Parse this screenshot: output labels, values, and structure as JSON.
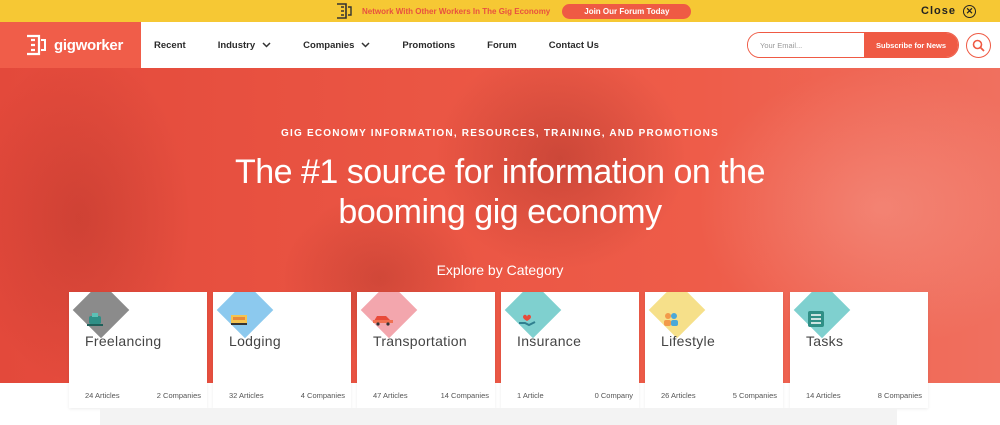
{
  "topbar": {
    "message": "Network With Other Workers In The Gig Economy",
    "button_label": "Join Our Forum Today",
    "close_label": "Close"
  },
  "header": {
    "logo_text": "gigworker",
    "nav": [
      {
        "label": "Recent",
        "has_dropdown": false
      },
      {
        "label": "Industry",
        "has_dropdown": true
      },
      {
        "label": "Companies",
        "has_dropdown": true
      },
      {
        "label": "Promotions",
        "has_dropdown": false
      },
      {
        "label": "Forum",
        "has_dropdown": false
      },
      {
        "label": "Contact Us",
        "has_dropdown": false
      }
    ],
    "email_placeholder": "Your Email...",
    "subscribe_label": "Subscribe for News"
  },
  "hero": {
    "kicker": "GIG ECONOMY INFORMATION, RESOURCES, TRAINING, AND PROMOTIONS",
    "title_line1": "The #1 source for information on the",
    "title_line2": "booming gig economy",
    "explore_label": "Explore by Category"
  },
  "categories": [
    {
      "name": "Freelancing",
      "articles": "24 Articles",
      "companies": "2 Companies",
      "color": "#8b8b8b",
      "icon": "sewing-machine-icon"
    },
    {
      "name": "Lodging",
      "articles": "32 Articles",
      "companies": "4 Companies",
      "color": "#8cc9ee",
      "icon": "bed-icon"
    },
    {
      "name": "Transportation",
      "articles": "47 Articles",
      "companies": "14 Companies",
      "color": "#f3a6ad",
      "icon": "car-icon"
    },
    {
      "name": "Insurance",
      "articles": "1 Article",
      "companies": "0 Company",
      "color": "#7fd0cf",
      "icon": "hand-heart-icon"
    },
    {
      "name": "Lifestyle",
      "articles": "26 Articles",
      "companies": "5 Companies",
      "color": "#f6e08a",
      "icon": "people-icon"
    },
    {
      "name": "Tasks",
      "articles": "14 Articles",
      "companies": "8 Companies",
      "color": "#7fd0cf",
      "icon": "clipboard-icon"
    }
  ],
  "colors": {
    "brand": "#ef5a44",
    "banner": "#f6c834"
  }
}
